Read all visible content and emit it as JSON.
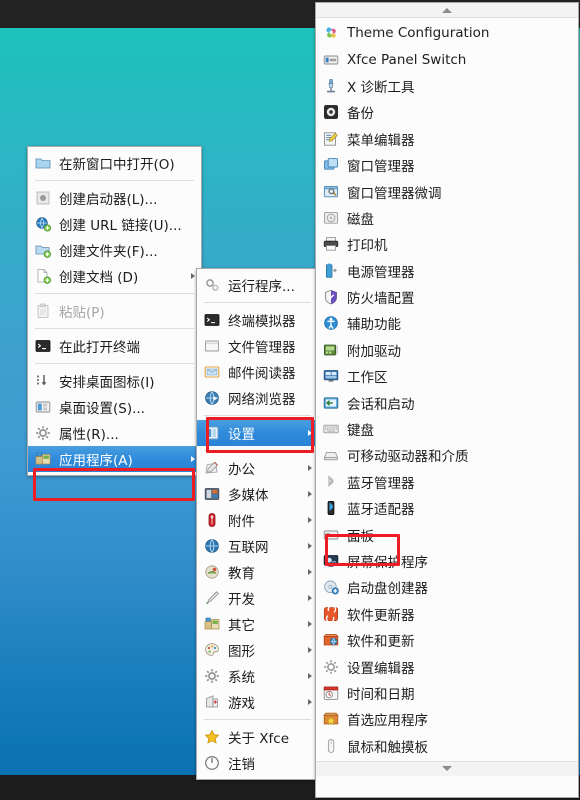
{
  "desktop": {
    "top_panel": "",
    "bottom_panel": "",
    "background_colors": {
      "top": "#19c5b8",
      "bottom": "#0c6fae"
    }
  },
  "accent": {
    "selection": "#2f8ada",
    "annotation": "#ee1c24"
  },
  "desktop_menu": {
    "name": "desktop-context-menu",
    "items": [
      {
        "label": "在新窗口中打开(O)",
        "icon": "folder-icon",
        "type": "item"
      },
      {
        "type": "separator"
      },
      {
        "label": "创建启动器(L)...",
        "icon": "launcher-icon",
        "type": "item"
      },
      {
        "label": "创建 URL 链接(U)...",
        "icon": "url-link-icon",
        "type": "item"
      },
      {
        "label": "创建文件夹(F)...",
        "icon": "new-folder-icon",
        "type": "item"
      },
      {
        "label": "创建文档 (D)",
        "icon": "new-document-icon",
        "type": "submenu"
      },
      {
        "type": "separator"
      },
      {
        "label": "粘贴(P)",
        "icon": "paste-icon",
        "type": "item",
        "disabled": true
      },
      {
        "type": "separator"
      },
      {
        "label": "在此打开终端",
        "icon": "terminal-icon",
        "type": "item"
      },
      {
        "type": "separator"
      },
      {
        "label": "安排桌面图标(I)",
        "icon": "arrange-icons-icon",
        "type": "item"
      },
      {
        "label": "桌面设置(S)...",
        "icon": "desktop-settings-icon",
        "type": "item"
      },
      {
        "label": "属性(R)...",
        "icon": "properties-gear-icon",
        "type": "item"
      },
      {
        "label": "应用程序(A)",
        "icon": "applications-icon",
        "type": "submenu",
        "selected": true,
        "highlighted": true
      }
    ]
  },
  "apps_menu": {
    "name": "applications-menu",
    "items": [
      {
        "label": "运行程序...",
        "icon": "run-program-icon",
        "type": "item"
      },
      {
        "type": "separator"
      },
      {
        "label": "终端模拟器",
        "icon": "terminal-icon",
        "type": "item"
      },
      {
        "label": "文件管理器",
        "icon": "file-manager-icon",
        "type": "item"
      },
      {
        "label": "邮件阅读器",
        "icon": "mail-reader-icon",
        "type": "item"
      },
      {
        "label": "网络浏览器",
        "icon": "web-browser-icon",
        "type": "item"
      },
      {
        "type": "separator"
      },
      {
        "label": "设置",
        "icon": "settings-icon",
        "type": "submenu",
        "selected": true,
        "highlighted": true
      },
      {
        "type": "separator"
      },
      {
        "label": "办公",
        "icon": "office-icon",
        "type": "submenu"
      },
      {
        "label": "多媒体",
        "icon": "multimedia-icon",
        "type": "submenu"
      },
      {
        "label": "附件",
        "icon": "accessories-icon",
        "type": "submenu"
      },
      {
        "label": "互联网",
        "icon": "internet-globe-icon",
        "type": "submenu"
      },
      {
        "label": "教育",
        "icon": "education-icon",
        "type": "submenu"
      },
      {
        "label": "开发",
        "icon": "development-icon",
        "type": "submenu"
      },
      {
        "label": "其它",
        "icon": "other-icon",
        "type": "submenu"
      },
      {
        "label": "图形",
        "icon": "graphics-icon",
        "type": "submenu"
      },
      {
        "label": "系统",
        "icon": "system-gear-icon",
        "type": "submenu"
      },
      {
        "label": "游戏",
        "icon": "games-icon",
        "type": "submenu"
      },
      {
        "type": "separator"
      },
      {
        "label": "关于 Xfce",
        "icon": "star-icon",
        "type": "item"
      },
      {
        "label": "注销",
        "icon": "logout-power-icon",
        "type": "item"
      }
    ]
  },
  "settings_menu": {
    "name": "settings-submenu",
    "scroll_up": "scroll-up-arrow",
    "scroll_down": "scroll-down-arrow",
    "items": [
      {
        "label": "Theme Configuration",
        "icon": "theme-configuration-icon"
      },
      {
        "label": "Xfce Panel Switch",
        "icon": "panel-switch-icon"
      },
      {
        "label": "X 诊断工具",
        "icon": "x-diagnostics-icon"
      },
      {
        "label": "备份",
        "icon": "backup-icon"
      },
      {
        "label": "菜单编辑器",
        "icon": "menu-editor-icon"
      },
      {
        "label": "窗口管理器",
        "icon": "window-manager-icon"
      },
      {
        "label": "窗口管理器微调",
        "icon": "window-manager-tweaks-icon"
      },
      {
        "label": "磁盘",
        "icon": "disks-icon"
      },
      {
        "label": "打印机",
        "icon": "printer-icon"
      },
      {
        "label": "电源管理器",
        "icon": "power-manager-icon"
      },
      {
        "label": "防火墙配置",
        "icon": "firewall-icon"
      },
      {
        "label": "辅助功能",
        "icon": "accessibility-icon"
      },
      {
        "label": "附加驱动",
        "icon": "additional-drivers-icon"
      },
      {
        "label": "工作区",
        "icon": "workspaces-icon"
      },
      {
        "label": "会话和启动",
        "icon": "session-startup-icon"
      },
      {
        "label": "键盘",
        "icon": "keyboard-icon"
      },
      {
        "label": "可移动驱动器和介质",
        "icon": "removable-drives-icon"
      },
      {
        "label": "蓝牙管理器",
        "icon": "bluetooth-manager-icon"
      },
      {
        "label": "蓝牙适配器",
        "icon": "bluetooth-adapter-icon"
      },
      {
        "label": "面板",
        "icon": "panel-icon",
        "highlighted": true
      },
      {
        "label": "屏幕保护程序",
        "icon": "screensaver-icon"
      },
      {
        "label": "启动盘创建器",
        "icon": "startup-disk-creator-icon"
      },
      {
        "label": "软件更新器",
        "icon": "software-updater-icon"
      },
      {
        "label": "软件和更新",
        "icon": "software-and-updates-icon"
      },
      {
        "label": "设置编辑器",
        "icon": "settings-editor-icon"
      },
      {
        "label": "时间和日期",
        "icon": "time-and-date-icon"
      },
      {
        "label": "首选应用程序",
        "icon": "preferred-applications-icon"
      },
      {
        "label": "鼠标和触摸板",
        "icon": "mouse-touchpad-icon"
      }
    ]
  }
}
